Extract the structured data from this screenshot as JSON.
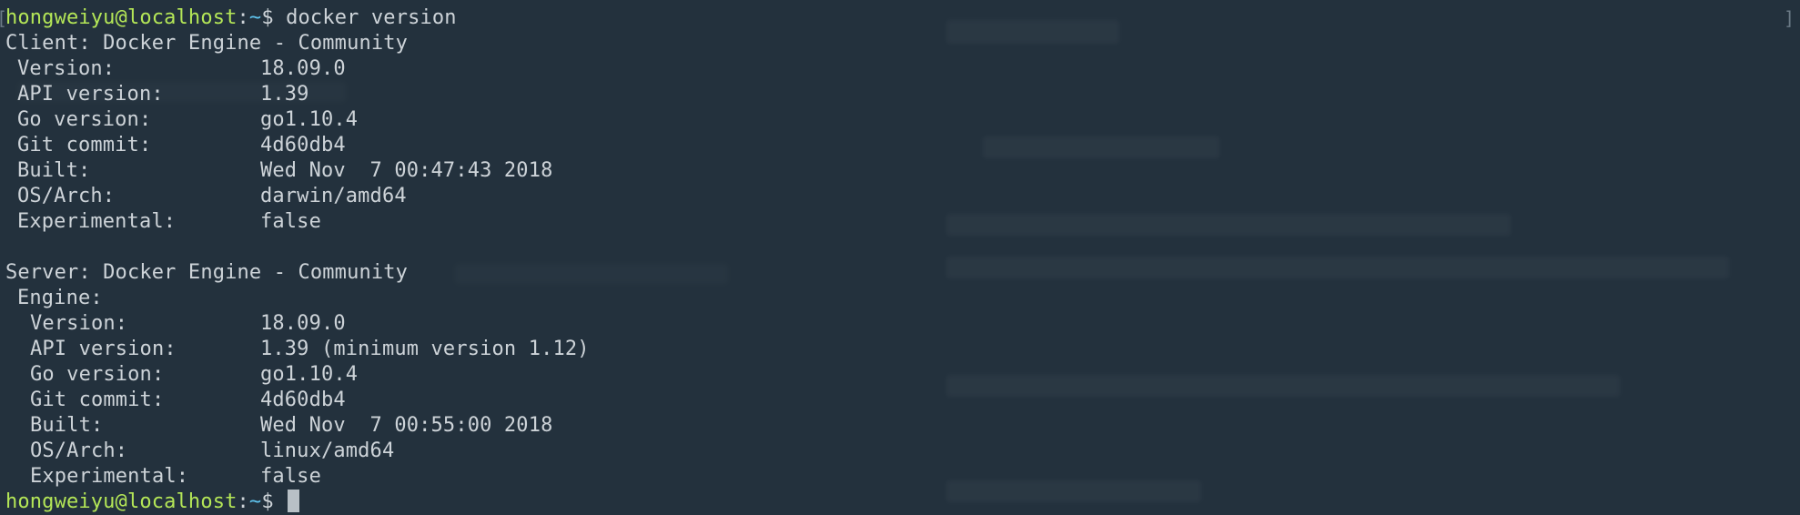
{
  "terminal": {
    "prompt_user": "hongweiyu@localhost",
    "prompt_dir": "~",
    "prompt_symbol": "$",
    "command": "docker version",
    "bracket_left": "[",
    "bracket_right": "]"
  },
  "client": {
    "header": "Client: Docker Engine - Community",
    "rows": [
      {
        "key": "Version:",
        "value": "18.09.0"
      },
      {
        "key": "API version:",
        "value": "1.39"
      },
      {
        "key": "Go version:",
        "value": "go1.10.4"
      },
      {
        "key": "Git commit:",
        "value": "4d60db4"
      },
      {
        "key": "Built:",
        "value": "Wed Nov  7 00:47:43 2018"
      },
      {
        "key": "OS/Arch:",
        "value": "darwin/amd64"
      },
      {
        "key": "Experimental:",
        "value": "false"
      }
    ]
  },
  "server": {
    "header": "Server: Docker Engine - Community",
    "engine_label": "Engine:",
    "rows": [
      {
        "key": "Version:",
        "value": "18.09.0"
      },
      {
        "key": "API version:",
        "value": "1.39 (minimum version 1.12)"
      },
      {
        "key": "Go version:",
        "value": "go1.10.4"
      },
      {
        "key": "Git commit:",
        "value": "4d60db4"
      },
      {
        "key": "Built:",
        "value": "Wed Nov  7 00:55:00 2018"
      },
      {
        "key": "OS/Arch:",
        "value": "linux/amd64"
      },
      {
        "key": "Experimental:",
        "value": "false"
      }
    ]
  },
  "colors": {
    "background": "#23313d",
    "text": "#cdd3d8",
    "user": "#b4e657",
    "dir": "#5fc4ef",
    "cursor": "#b8c0c6"
  }
}
